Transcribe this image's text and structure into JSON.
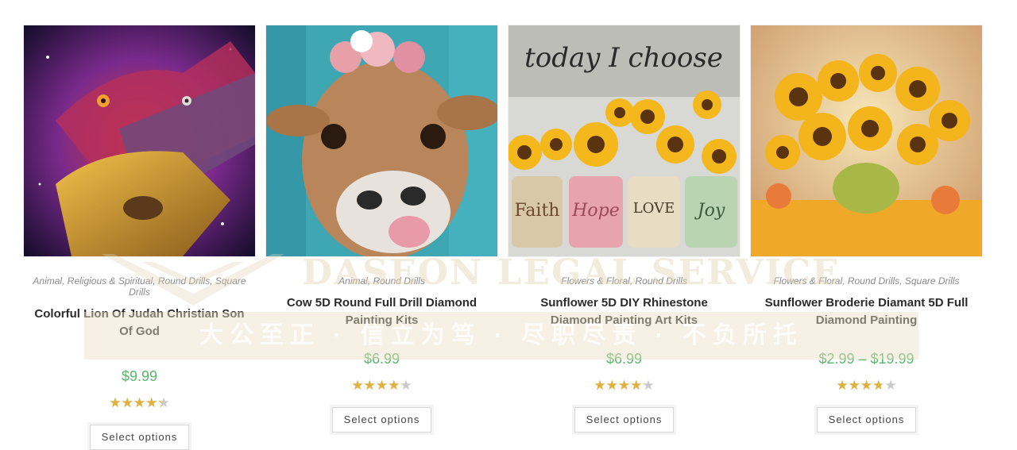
{
  "products": [
    {
      "categories": [
        "Animal",
        "Religious & Spiritual",
        "Round Drills",
        "Square Drills"
      ],
      "title": "Colorful Lion Of Judah Christian Son Of God",
      "price": "$9.99",
      "rating": 4.3,
      "button_label": "Select options"
    },
    {
      "categories": [
        "Animal",
        "Round Drills"
      ],
      "title": "Cow 5D Round Full Drill Diamond Painting Kits",
      "price": "$6.99",
      "rating": 4.2,
      "button_label": "Select options"
    },
    {
      "categories": [
        "Flowers & Floral",
        "Round Drills"
      ],
      "title": "Sunflower 5D DIY Rhinestone Diamond Painting Art Kits",
      "price": "$6.99",
      "rating": 4.2,
      "button_label": "Select options"
    },
    {
      "categories": [
        "Flowers & Floral",
        "Round Drills",
        "Square Drills"
      ],
      "title": "Sunflower Broderie Diamant 5D Full Diamond Painting",
      "price": "$2.99 – $19.99",
      "rating": 3.7,
      "button_label": "Select options"
    }
  ],
  "artwork": {
    "jar_labels": [
      "Faith",
      "Hope",
      "LOVE",
      "Joy"
    ],
    "sign_text": "today I choose"
  },
  "watermark": {
    "logo_text": "DASEON LEGAL SERVICE",
    "band_text": "大公至正 · 信立为笃 · 尽职尽责 · 不负所托"
  },
  "colors": {
    "price": "#59b46a",
    "star_filled": "#e0b13c",
    "star_empty": "#c9c9c9"
  }
}
